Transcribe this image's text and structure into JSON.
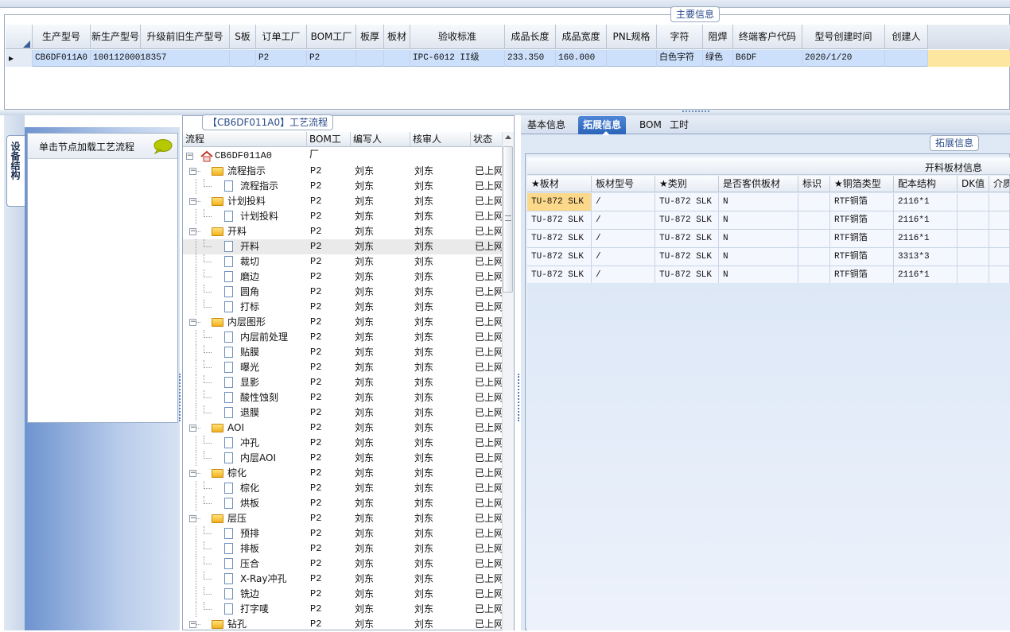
{
  "main_info": {
    "legend": "主要信息",
    "columns": [
      "生产型号",
      "新生产型号",
      "升级前旧生产型号",
      "S板",
      "订单工厂",
      "BOM工厂",
      "板厚",
      "板材",
      "验收标准",
      "成品长度",
      "成品宽度",
      "PNL规格",
      "字符",
      "阻焊",
      "终端客户代码",
      "型号创建时间",
      "创建人"
    ],
    "row": [
      "CB6DF011A0",
      "10011200018357",
      "",
      "",
      "P2",
      "P2",
      "",
      "",
      "IPC-6012 II级",
      "233.350",
      "160.000",
      "",
      "白色字符",
      "绿色",
      "B6DF",
      "2020/1/20",
      ""
    ]
  },
  "device_tab": {
    "label": "设备结构"
  },
  "load_panel": {
    "title": "单击节点加载工艺流程"
  },
  "process": {
    "legend": "【CB6DF011A0】工艺流程",
    "columns": [
      "流程",
      "BOM工厂",
      "编写人",
      "核审人",
      "状态"
    ],
    "nodes": [
      {
        "name": "CB6DF011A0",
        "level": 0,
        "kind": "root",
        "factory": "",
        "writer": "",
        "reviewer": "",
        "status": ""
      },
      {
        "name": "流程指示",
        "level": 1,
        "kind": "folder",
        "factory": "P2",
        "writer": "刘东",
        "reviewer": "刘东",
        "status": "已上网"
      },
      {
        "name": "流程指示",
        "level": 2,
        "kind": "doc",
        "factory": "P2",
        "writer": "刘东",
        "reviewer": "刘东",
        "status": "已上网"
      },
      {
        "name": "计划投料",
        "level": 1,
        "kind": "folder",
        "factory": "P2",
        "writer": "刘东",
        "reviewer": "刘东",
        "status": "已上网"
      },
      {
        "name": "计划投料",
        "level": 2,
        "kind": "doc",
        "factory": "P2",
        "writer": "刘东",
        "reviewer": "刘东",
        "status": "已上网"
      },
      {
        "name": "开料",
        "level": 1,
        "kind": "folder",
        "factory": "P2",
        "writer": "刘东",
        "reviewer": "刘东",
        "status": "已上网"
      },
      {
        "name": "开料",
        "level": 2,
        "kind": "doc",
        "factory": "P2",
        "writer": "刘东",
        "reviewer": "刘东",
        "status": "已上网",
        "selected": true
      },
      {
        "name": "裁切",
        "level": 2,
        "kind": "doc",
        "factory": "P2",
        "writer": "刘东",
        "reviewer": "刘东",
        "status": "已上网"
      },
      {
        "name": "磨边",
        "level": 2,
        "kind": "doc",
        "factory": "P2",
        "writer": "刘东",
        "reviewer": "刘东",
        "status": "已上网"
      },
      {
        "name": "圆角",
        "level": 2,
        "kind": "doc",
        "factory": "P2",
        "writer": "刘东",
        "reviewer": "刘东",
        "status": "已上网"
      },
      {
        "name": "打标",
        "level": 2,
        "kind": "doc",
        "factory": "P2",
        "writer": "刘东",
        "reviewer": "刘东",
        "status": "已上网"
      },
      {
        "name": "内层图形",
        "level": 1,
        "kind": "folder",
        "factory": "P2",
        "writer": "刘东",
        "reviewer": "刘东",
        "status": "已上网"
      },
      {
        "name": "内层前处理",
        "level": 2,
        "kind": "doc",
        "factory": "P2",
        "writer": "刘东",
        "reviewer": "刘东",
        "status": "已上网"
      },
      {
        "name": "贴膜",
        "level": 2,
        "kind": "doc",
        "factory": "P2",
        "writer": "刘东",
        "reviewer": "刘东",
        "status": "已上网"
      },
      {
        "name": "曝光",
        "level": 2,
        "kind": "doc",
        "factory": "P2",
        "writer": "刘东",
        "reviewer": "刘东",
        "status": "已上网"
      },
      {
        "name": "显影",
        "level": 2,
        "kind": "doc",
        "factory": "P2",
        "writer": "刘东",
        "reviewer": "刘东",
        "status": "已上网"
      },
      {
        "name": "酸性蚀刻",
        "level": 2,
        "kind": "doc",
        "factory": "P2",
        "writer": "刘东",
        "reviewer": "刘东",
        "status": "已上网"
      },
      {
        "name": "退膜",
        "level": 2,
        "kind": "doc",
        "factory": "P2",
        "writer": "刘东",
        "reviewer": "刘东",
        "status": "已上网"
      },
      {
        "name": "AOI",
        "level": 1,
        "kind": "folder",
        "factory": "P2",
        "writer": "刘东",
        "reviewer": "刘东",
        "status": "已上网"
      },
      {
        "name": "冲孔",
        "level": 2,
        "kind": "doc",
        "factory": "P2",
        "writer": "刘东",
        "reviewer": "刘东",
        "status": "已上网"
      },
      {
        "name": "内层AOI",
        "level": 2,
        "kind": "doc",
        "factory": "P2",
        "writer": "刘东",
        "reviewer": "刘东",
        "status": "已上网"
      },
      {
        "name": "棕化",
        "level": 1,
        "kind": "folder",
        "factory": "P2",
        "writer": "刘东",
        "reviewer": "刘东",
        "status": "已上网"
      },
      {
        "name": "棕化",
        "level": 2,
        "kind": "doc",
        "factory": "P2",
        "writer": "刘东",
        "reviewer": "刘东",
        "status": "已上网"
      },
      {
        "name": "烘板",
        "level": 2,
        "kind": "doc",
        "factory": "P2",
        "writer": "刘东",
        "reviewer": "刘东",
        "status": "已上网"
      },
      {
        "name": "层压",
        "level": 1,
        "kind": "folder",
        "factory": "P2",
        "writer": "刘东",
        "reviewer": "刘东",
        "status": "已上网"
      },
      {
        "name": "预排",
        "level": 2,
        "kind": "doc",
        "factory": "P2",
        "writer": "刘东",
        "reviewer": "刘东",
        "status": "已上网"
      },
      {
        "name": "排板",
        "level": 2,
        "kind": "doc",
        "factory": "P2",
        "writer": "刘东",
        "reviewer": "刘东",
        "status": "已上网"
      },
      {
        "name": "压合",
        "level": 2,
        "kind": "doc",
        "factory": "P2",
        "writer": "刘东",
        "reviewer": "刘东",
        "status": "已上网"
      },
      {
        "name": "X-Ray冲孔",
        "level": 2,
        "kind": "doc",
        "factory": "P2",
        "writer": "刘东",
        "reviewer": "刘东",
        "status": "已上网"
      },
      {
        "name": "铣边",
        "level": 2,
        "kind": "doc",
        "factory": "P2",
        "writer": "刘东",
        "reviewer": "刘东",
        "status": "已上网"
      },
      {
        "name": "打字唛",
        "level": 2,
        "kind": "doc",
        "factory": "P2",
        "writer": "刘东",
        "reviewer": "刘东",
        "status": "已上网"
      },
      {
        "name": "钻孔",
        "level": 1,
        "kind": "folder",
        "factory": "P2",
        "writer": "刘东",
        "reviewer": "刘东",
        "status": "已上网"
      }
    ]
  },
  "tabs": [
    "基本信息",
    "拓展信息",
    "BOM",
    "工时"
  ],
  "active_tab": "拓展信息",
  "ext_info": {
    "legend": "拓展信息",
    "caption": "开料板材信息",
    "columns": [
      "★板材",
      "板材型号",
      "★类别",
      "是否客供板材",
      "标识",
      "★铜箔类型",
      "配本结构",
      "DK值",
      "介质"
    ],
    "rows": [
      [
        "TU-872 SLK",
        "/",
        "TU-872 SLK",
        "N",
        "",
        "RTF铜箔",
        "2116*1",
        "",
        ""
      ],
      [
        "TU-872 SLK",
        "/",
        "TU-872 SLK",
        "N",
        "",
        "RTF铜箔",
        "2116*1",
        "",
        ""
      ],
      [
        "TU-872 SLK",
        "/",
        "TU-872 SLK",
        "N",
        "",
        "RTF铜箔",
        "2116*1",
        "",
        ""
      ],
      [
        "TU-872 SLK",
        "/",
        "TU-872 SLK",
        "N",
        "",
        "RTF铜箔",
        "3313*3",
        "",
        ""
      ],
      [
        "TU-872 SLK",
        "/",
        "TU-872 SLK",
        "N",
        "",
        "RTF铜箔",
        "2116*1",
        "",
        ""
      ]
    ]
  },
  "colors": {
    "accent": "#2a63b8",
    "selected_row": "#cde0fb",
    "highlight_cell": "#fcd98a",
    "folder": "#f2b11e",
    "bubble": "#b5c800"
  }
}
